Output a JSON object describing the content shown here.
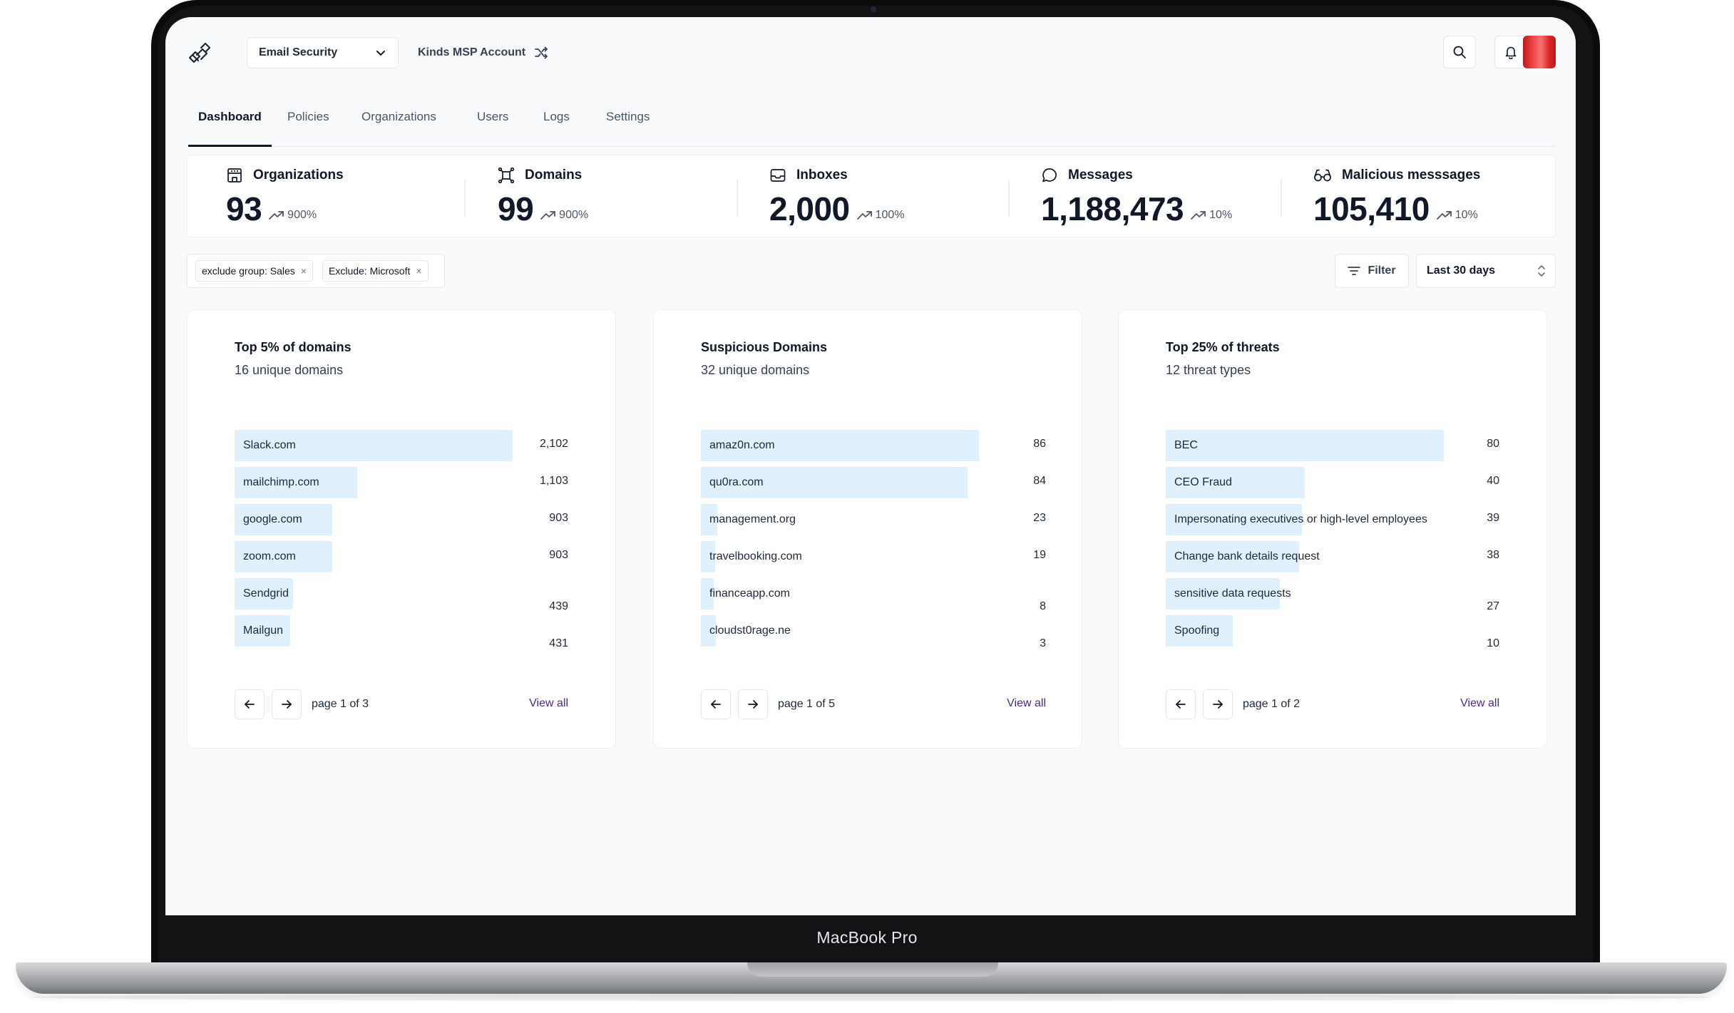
{
  "device": {
    "label": "MacBook Pro"
  },
  "topbar": {
    "product": "Email Security",
    "account": "Kinds MSP Account"
  },
  "tabs": [
    {
      "label": "Dashboard",
      "active": true
    },
    {
      "label": "Policies",
      "active": false
    },
    {
      "label": "Organizations",
      "active": false
    },
    {
      "label": "Users",
      "active": false
    },
    {
      "label": "Logs",
      "active": false
    },
    {
      "label": "Settings",
      "active": false
    }
  ],
  "stats": [
    {
      "label": "Organizations",
      "value": "93",
      "change": "900%",
      "icon": "building-icon"
    },
    {
      "label": "Domains",
      "value": "99",
      "change": "900%",
      "icon": "domain-network-icon"
    },
    {
      "label": "Inboxes",
      "value": "2,000",
      "change": "100%",
      "icon": "inbox-icon"
    },
    {
      "label": "Messages",
      "value": "1,188,473",
      "change": "10%",
      "icon": "message-bubble-icon"
    },
    {
      "label": "Malicious messsages",
      "value": "105,410",
      "change": "10%",
      "icon": "spy-glasses-icon"
    }
  ],
  "filters": {
    "chips": [
      "exclude group: Sales",
      "Exclude: Microsoft"
    ],
    "chip_remove_symbol": "×",
    "filter_label": "Filter",
    "range_label": "Last 30 days"
  },
  "cards": [
    {
      "title": "Top 5% of domains",
      "subtitle": "16 unique domains",
      "rows": [
        {
          "label": "Slack.com",
          "value": "2,102",
          "fill": 1.0
        },
        {
          "label": "mailchimp.com",
          "value": "1,103",
          "fill": 0.44
        },
        {
          "label": "google.com",
          "value": "903",
          "fill": 0.35
        },
        {
          "label": "zoom.com",
          "value": "903",
          "fill": 0.35
        },
        {
          "label": "Sendgrid",
          "value": "439",
          "fill": 0.21
        },
        {
          "label": "Mailgun",
          "value": "431",
          "fill": 0.2
        }
      ],
      "page": "page 1 of 3",
      "view_all": "View all"
    },
    {
      "title": "Suspicious Domains",
      "subtitle": "32 unique domains",
      "rows": [
        {
          "label": "amaz0n.com",
          "value": "86",
          "fill": 1.0
        },
        {
          "label": "qu0ra.com",
          "value": "84",
          "fill": 0.96
        },
        {
          "label": "management.org",
          "value": "23",
          "fill": 0.06
        },
        {
          "label": "travelbooking.com",
          "value": "19",
          "fill": 0.05
        },
        {
          "label": "financeapp.com",
          "value": "8",
          "fill": 0.04
        },
        {
          "label": "cloudst0rage.ne",
          "value": "3",
          "fill": 0.055
        }
      ],
      "page": "page 1 of 5",
      "view_all": "View all"
    },
    {
      "title": "Top 25% of threats",
      "subtitle": "12 threat types",
      "rows": [
        {
          "label": "BEC",
          "value": "80",
          "fill": 1.0
        },
        {
          "label": "CEO Fraud",
          "value": "40",
          "fill": 0.5
        },
        {
          "label": "Impersonating executives or high-level employees",
          "value": "39",
          "fill": 0.49
        },
        {
          "label": "Change bank details request",
          "value": "38",
          "fill": 0.48
        },
        {
          "label": "sensitive data requests",
          "value": "27",
          "fill": 0.41
        },
        {
          "label": "Spoofing",
          "value": "10",
          "fill": 0.24
        }
      ],
      "page": "page 1 of 2",
      "view_all": "View all"
    }
  ],
  "colors": {
    "bar": "#e0f0fc",
    "link": "#4c2889",
    "avatar": "#dc2626"
  }
}
